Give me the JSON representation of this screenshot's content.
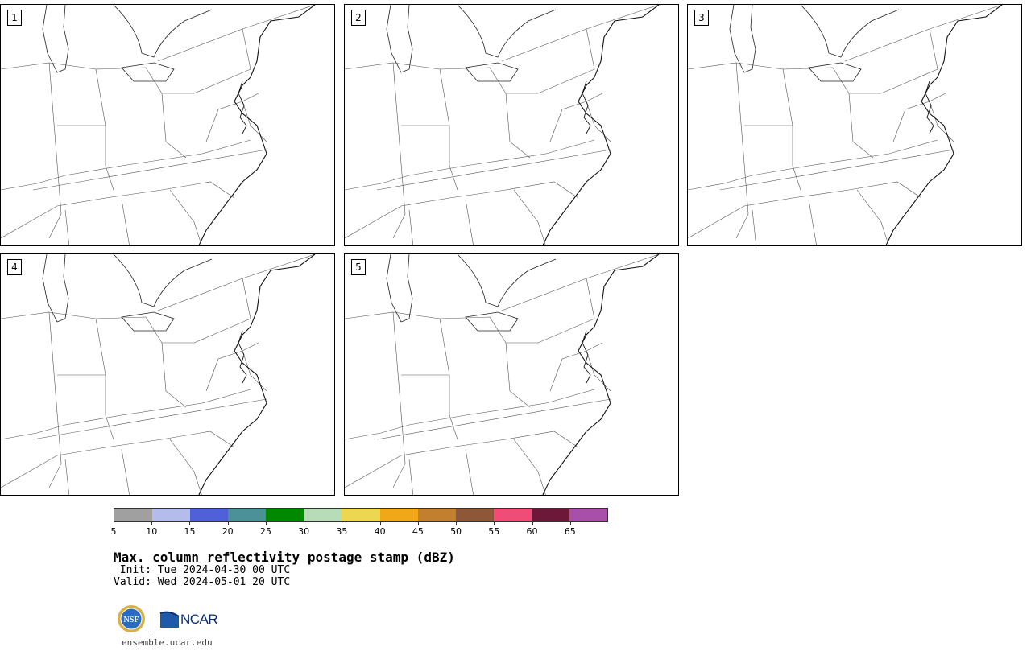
{
  "panels": [
    {
      "label": "1"
    },
    {
      "label": "2"
    },
    {
      "label": "3"
    },
    {
      "label": "4"
    },
    {
      "label": "5"
    }
  ],
  "colorbar": {
    "ticks": [
      "5",
      "10",
      "15",
      "20",
      "25",
      "30",
      "35",
      "40",
      "45",
      "50",
      "55",
      "60",
      "65"
    ],
    "colors": [
      "#a0a0a0",
      "#b4bcec",
      "#5060d8",
      "#4c9098",
      "#008800",
      "#b8dcb8",
      "#ecd850",
      "#f0a818",
      "#c08030",
      "#8c5838",
      "#f04c78",
      "#6c1838",
      "#a850a8"
    ]
  },
  "title": "Max. column reflectivity postage stamp (dBZ)",
  "init": " Init: Tue 2024-04-30 00 UTC",
  "valid": "Valid: Wed 2024-05-01 20 UTC",
  "logo": {
    "agency": "NCAR",
    "seal": "NSF"
  },
  "website": "ensemble.ucar.edu"
}
